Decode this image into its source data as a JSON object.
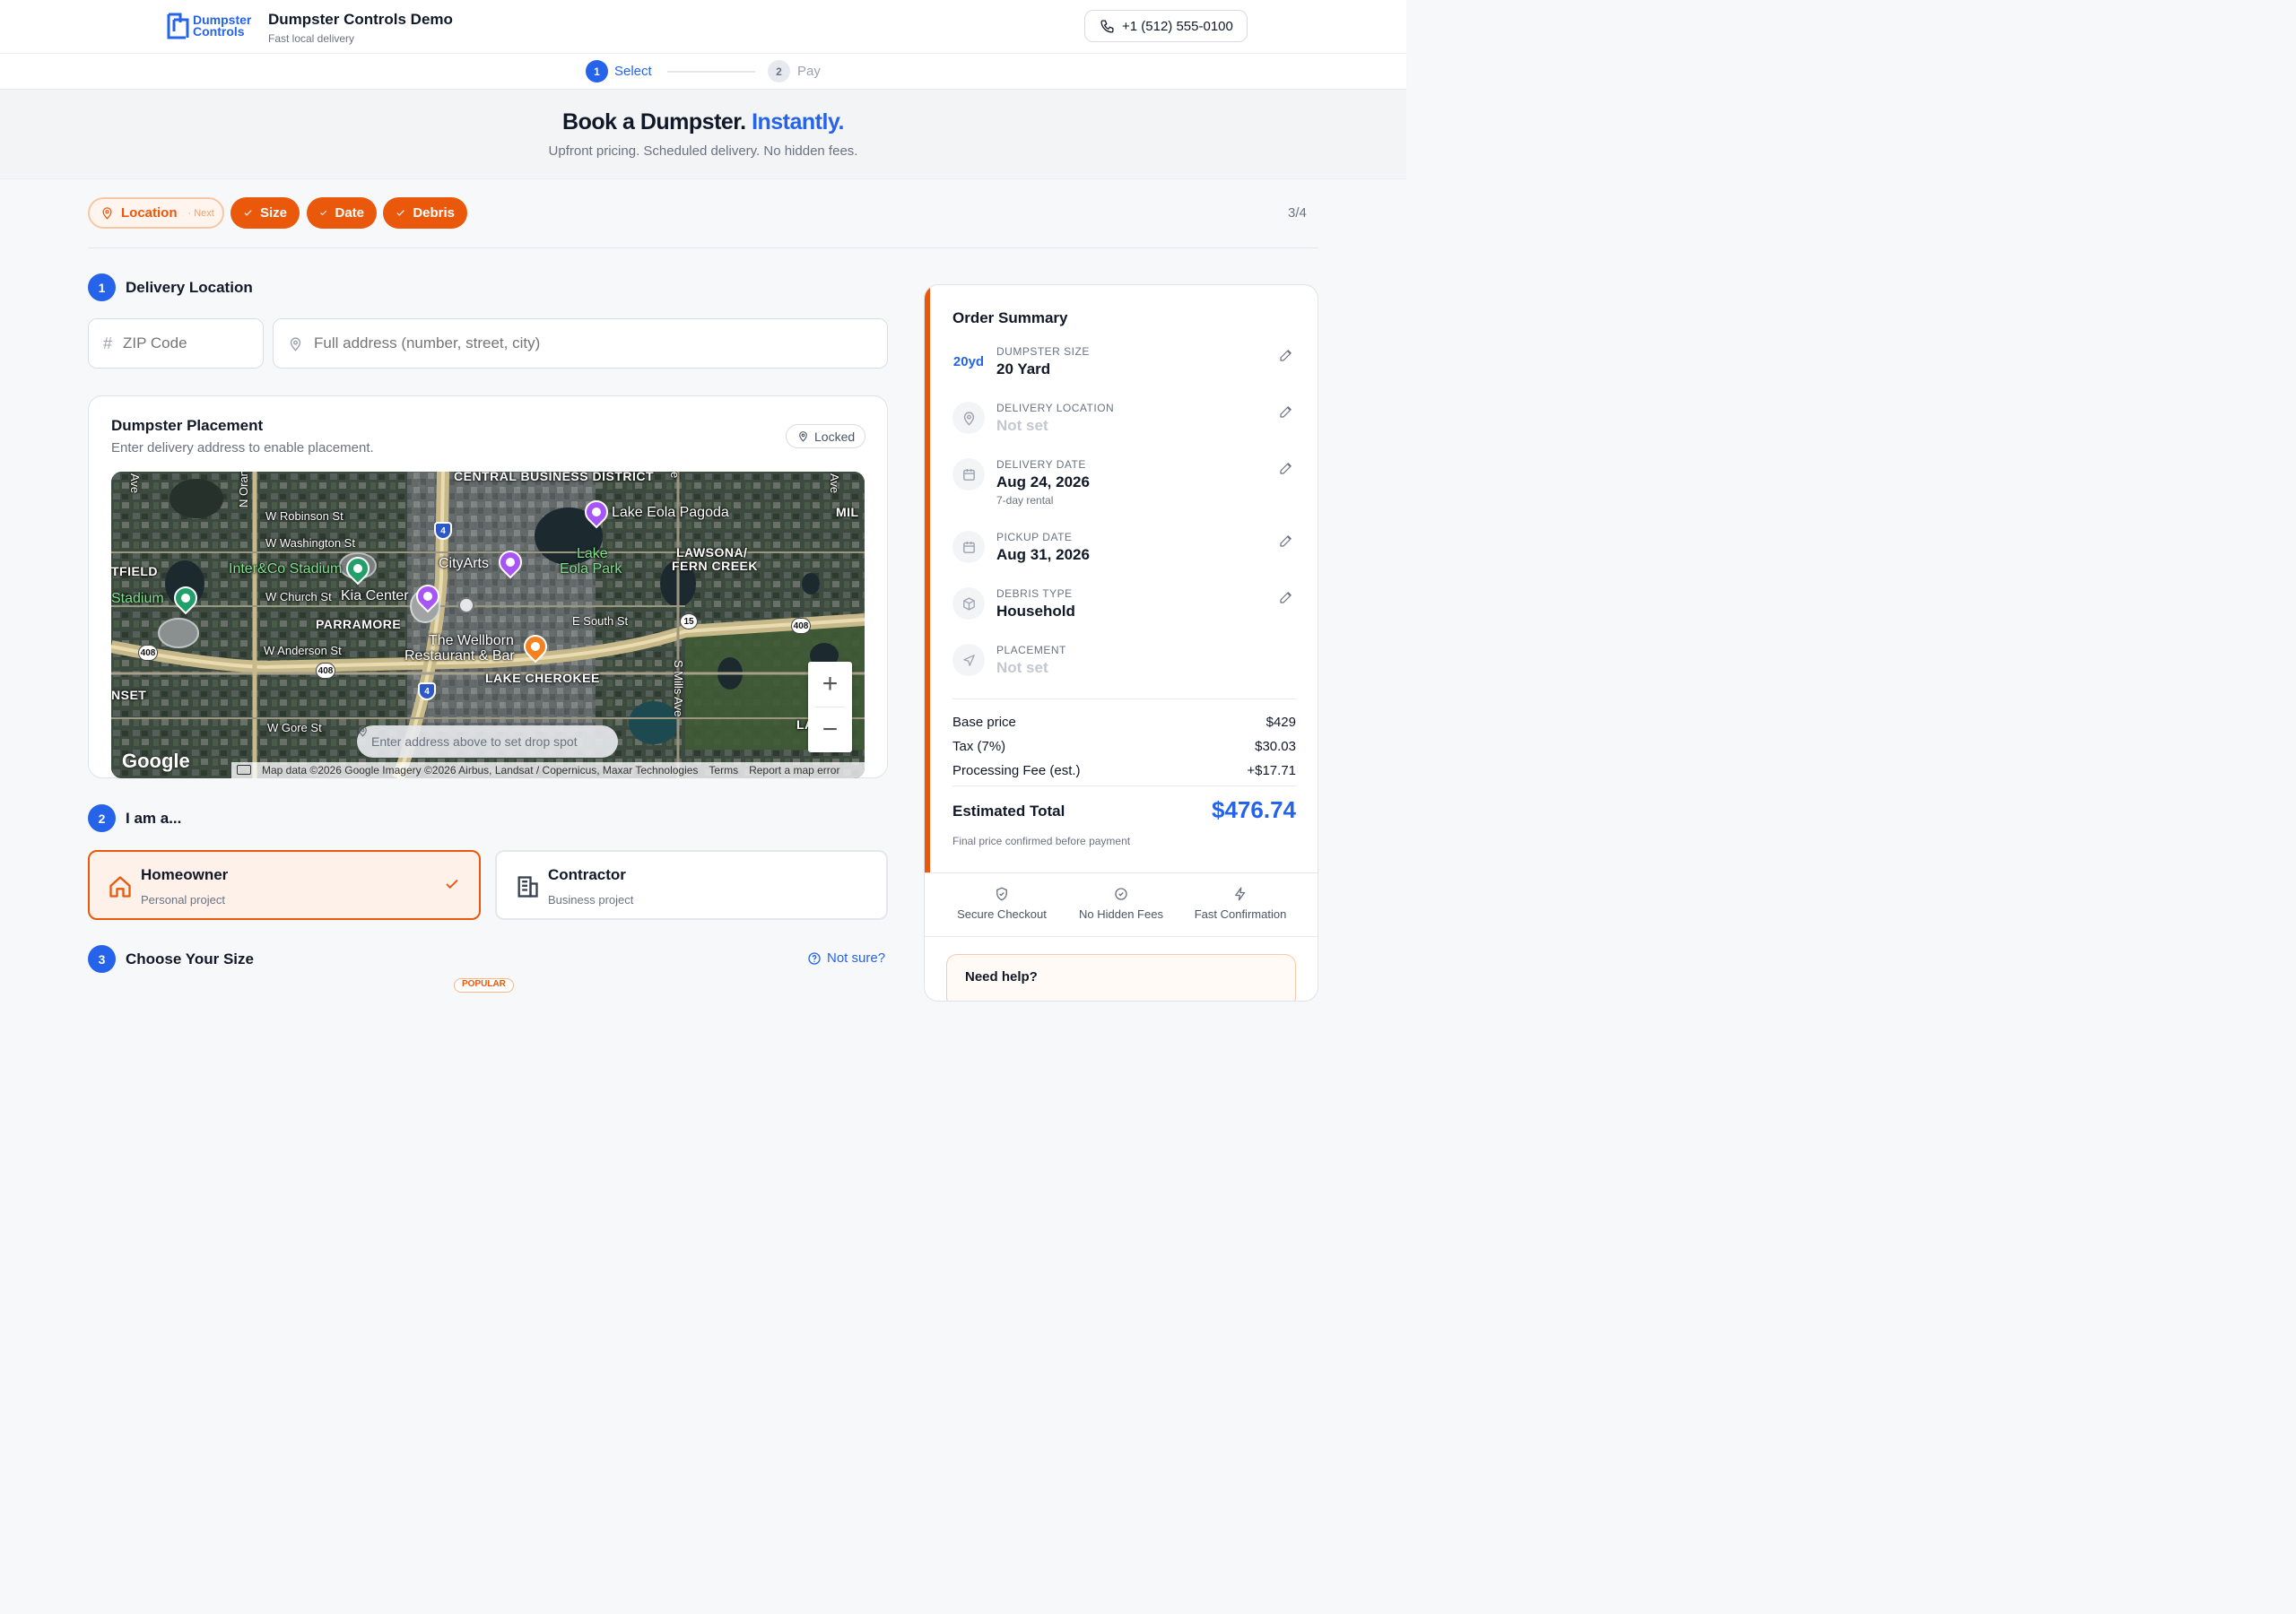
{
  "header": {
    "logo_line1": "Dumpster",
    "logo_line2": "Controls",
    "title": "Dumpster Controls Demo",
    "subtitle": "Fast local delivery",
    "phone": "+1 (512) 555-0100"
  },
  "stepper": {
    "steps": [
      {
        "number": "1",
        "label": "Select",
        "active": true
      },
      {
        "number": "2",
        "label": "Pay",
        "active": false
      }
    ]
  },
  "hero": {
    "title_main": "Book a Dumpster.",
    "title_accent": "Instantly.",
    "subtitle": "Upfront pricing. Scheduled delivery. No hidden fees."
  },
  "progress": {
    "chips": [
      {
        "label": "Location",
        "suffix": "· Next",
        "icon": "map-pin-icon",
        "state": "next"
      },
      {
        "label": "Size",
        "icon": "check-icon",
        "state": "done"
      },
      {
        "label": "Date",
        "icon": "check-icon",
        "state": "done"
      },
      {
        "label": "Debris",
        "icon": "check-icon",
        "state": "done"
      }
    ],
    "count": "3/4"
  },
  "sections": {
    "location": {
      "number": "1",
      "title": "Delivery Location"
    },
    "role": {
      "number": "2",
      "title": "I am a..."
    },
    "size": {
      "number": "3",
      "title": "Choose Your Size",
      "help_link": "Not sure?",
      "badge": "POPULAR"
    }
  },
  "inputs": {
    "zip": {
      "placeholder": "ZIP Code",
      "value": ""
    },
    "address": {
      "placeholder": "Full address (number, street, city)",
      "value": ""
    }
  },
  "placement": {
    "title": "Dumpster Placement",
    "subtitle": "Enter delivery address to enable placement.",
    "status": "Locked",
    "map": {
      "labels": {
        "cbd": "CENTRAL BUSINESS DISTRICT",
        "robinson": "W Robinson St",
        "washington": "W Washington St",
        "church": "W Church St",
        "anderson": "W Anderson St",
        "gore": "W Gore St",
        "southst": "E South St",
        "orange": "N Orange Blos",
        "millsave": "S Mills Ave",
        "parramore": "PARRAMORE",
        "lawsona": "LAWSONA/",
        "ferncreek": "FERN CREEK",
        "lakecherokee": "LAKE CHEROKEE",
        "tfield": "TFIELD",
        "nset": "NSET",
        "mil": "MIL",
        "ave1": "Ave",
        "ave2": "Ave",
        "ave3": "e",
        "lao": "LA",
        "poi_stadium1": "Inter&Co Stadium",
        "poi_stadium2": "Stadium",
        "poi_kia": "Kia Center",
        "poi_cityarts": "CityArts",
        "poi_lakeeola_pagoda": "Lake Eola Pagoda",
        "poi_lakeeola_park_1": "Lake",
        "poi_lakeeola_park_2": "Eola Park",
        "poi_wellborn_1": "The Wellborn",
        "poi_wellborn_2": "Restaurant & Bar"
      },
      "shields": [
        "4",
        "4",
        "408",
        "408",
        "408",
        "15"
      ],
      "drop_hint": "Enter address above to set drop spot",
      "google": "Google",
      "attribution": "Map data ©2026 Google Imagery ©2026 Airbus, Landsat / Copernicus, Maxar Technologies",
      "terms": "Terms",
      "report": "Report a map error",
      "zoom_in": "+",
      "zoom_out": "−"
    }
  },
  "roles": [
    {
      "title": "Homeowner",
      "subtitle": "Personal project",
      "icon": "home-icon",
      "selected": true
    },
    {
      "title": "Contractor",
      "subtitle": "Business project",
      "icon": "building-icon",
      "selected": false
    }
  ],
  "summary": {
    "title": "Order Summary",
    "rows": [
      {
        "icon_text": "20yd",
        "label": "DUMPSTER SIZE",
        "value": "20 Yard",
        "set": true
      },
      {
        "icon": "map-pin-icon",
        "label": "DELIVERY LOCATION",
        "value": "Not set",
        "set": false
      },
      {
        "icon": "calendar-icon",
        "label": "DELIVERY DATE",
        "value": "Aug 24, 2026",
        "note": "7-day rental",
        "set": true
      },
      {
        "icon": "calendar-icon",
        "label": "PICKUP DATE",
        "value": "Aug 31, 2026",
        "set": true
      },
      {
        "icon": "box-icon",
        "label": "DEBRIS TYPE",
        "value": "Household",
        "set": true
      },
      {
        "icon": "navigation-icon",
        "label": "PLACEMENT",
        "value": "Not set",
        "set": false
      }
    ],
    "prices": [
      {
        "label": "Base price",
        "value": "$429"
      },
      {
        "label": "Tax (7%)",
        "value": "$30.03"
      },
      {
        "label": "Processing Fee (est.)",
        "value": "+$17.71"
      }
    ],
    "total_label": "Estimated Total",
    "total_value": "$476.74",
    "final_note": "Final price confirmed before payment",
    "trust": [
      {
        "label": "Secure Checkout",
        "icon": "shield-icon"
      },
      {
        "label": "No Hidden Fees",
        "icon": "badge-check-icon"
      },
      {
        "label": "Fast Confirmation",
        "icon": "bolt-icon"
      }
    ],
    "help_title": "Need help?"
  },
  "colors": {
    "primary": "#2563eb",
    "accent": "#ea580c"
  }
}
